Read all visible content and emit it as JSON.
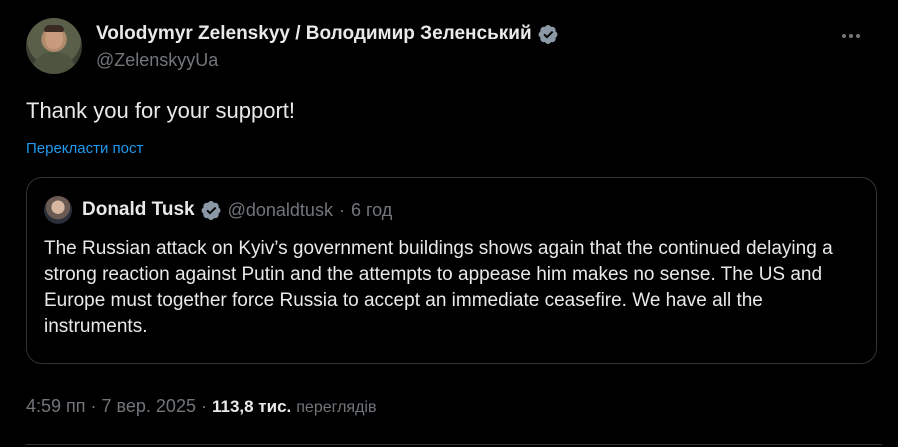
{
  "author": {
    "display_name": "Volodymyr Zelenskyy / Володимир Зеленський",
    "handle": "@ZelenskyyUa",
    "verified": true,
    "avatar_icon": "profile-photo"
  },
  "more_icon": "more-horizontal-icon",
  "tweet": {
    "text": "Thank you for your support!",
    "translate_label": "Перекласти пост"
  },
  "quote": {
    "display_name": "Donald Tusk",
    "verified": true,
    "handle": "@donaldtusk",
    "separator": "·",
    "time": "6 год",
    "text": "The Russian attack on Kyiv’s government buildings shows again that the continued delaying a strong reaction against Putin and the attempts to appease him makes no sense. The US and Europe must together force Russia to accept an immediate ceasefire. We have all the instruments."
  },
  "meta": {
    "timestamp": "4:59 пп · 7 вер. 2025",
    "separator": "·",
    "views_count": "113,8 тис.",
    "views_label": "переглядів"
  },
  "colors": {
    "background": "#000000",
    "text_primary": "#e7e9ea",
    "text_secondary": "#71767b",
    "link": "#1d9bf0",
    "verified_badge": "#8b98a5",
    "border": "#2f3336"
  }
}
